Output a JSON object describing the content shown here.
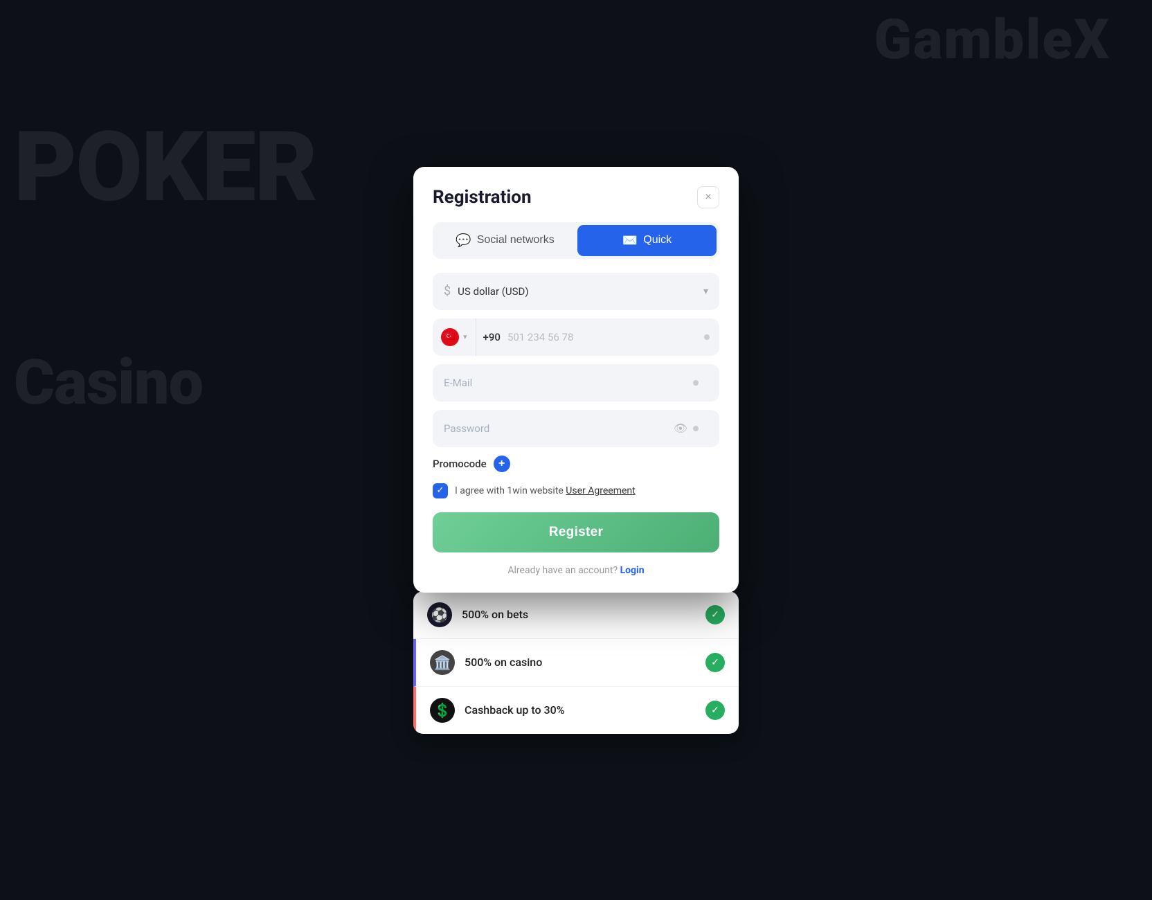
{
  "background": {
    "poker_text": "POKER",
    "casino_text": "Casino",
    "logo_text": "GambleX"
  },
  "modal": {
    "title": "Registration",
    "close_label": "×",
    "tabs": [
      {
        "id": "social",
        "label": "Social networks",
        "icon": "💬",
        "active": false
      },
      {
        "id": "quick",
        "label": "Quick",
        "icon": "✉️",
        "active": true
      }
    ],
    "currency": {
      "label": "US dollar (USD)",
      "placeholder": "US dollar (USD)"
    },
    "phone": {
      "flag": "🇹🇷",
      "country_code": "+90",
      "placeholder": "501 234 56 78"
    },
    "email": {
      "placeholder": "E-Mail"
    },
    "password": {
      "placeholder": "Password"
    },
    "promocode": {
      "label": "Promocode",
      "btn_label": "+"
    },
    "agreement": {
      "text": "I agree with 1win website ",
      "link_text": "User Agreement"
    },
    "register_btn": "Register",
    "already_account": "Already have an account?",
    "login_link": "Login"
  },
  "bonuses": [
    {
      "icon": "⚽",
      "text": "500% on bets",
      "bg": "#1a1a2e"
    },
    {
      "icon": "🏛️",
      "text": "500% on casino",
      "bg": "#333"
    },
    {
      "icon": "💲",
      "text": "Cashback up to 30%",
      "bg": "#111"
    }
  ]
}
